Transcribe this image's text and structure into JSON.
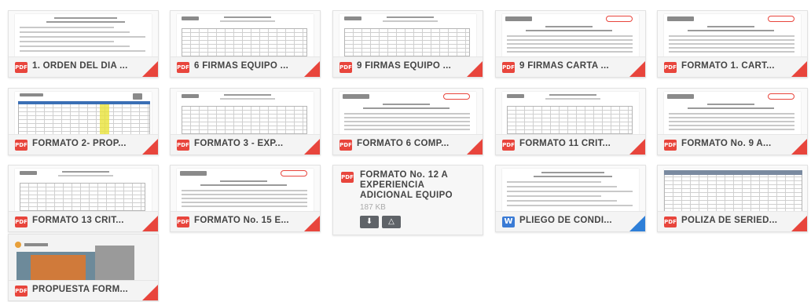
{
  "files": [
    {
      "name": "1. ORDEN DEL DÍA ...",
      "type": "PDF",
      "icon": "pdf-icon",
      "thumb": "text"
    },
    {
      "name": "6 FIRMAS EQUIPO ...",
      "type": "PDF",
      "icon": "pdf-icon",
      "thumb": "table"
    },
    {
      "name": "9 FIRMAS EQUIPO ...",
      "type": "PDF",
      "icon": "pdf-icon",
      "thumb": "table"
    },
    {
      "name": "9 FIRMAS CARTA ...",
      "type": "PDF",
      "icon": "pdf-icon",
      "thumb": "letter"
    },
    {
      "name": "FORMATO 1. CART...",
      "type": "PDF",
      "icon": "pdf-icon",
      "thumb": "letter"
    },
    {
      "name": "FORMATO 2- PROP...",
      "type": "PDF",
      "icon": "pdf-icon",
      "thumb": "spreadsheet"
    },
    {
      "name": "FORMATO 3 - EXP...",
      "type": "PDF",
      "icon": "pdf-icon",
      "thumb": "table"
    },
    {
      "name": "FORMATO 6 COMP...",
      "type": "PDF",
      "icon": "pdf-icon",
      "thumb": "letter"
    },
    {
      "name": "FORMATO 11 CRIT...",
      "type": "PDF",
      "icon": "pdf-icon",
      "thumb": "table"
    },
    {
      "name": "FORMATO No. 9 A...",
      "type": "PDF",
      "icon": "pdf-icon",
      "thumb": "letter"
    },
    {
      "name": "FORMATO 13 CRIT...",
      "type": "PDF",
      "icon": "pdf-icon",
      "thumb": "table"
    },
    {
      "name": "FORMATO No. 15 E...",
      "type": "PDF",
      "icon": "pdf-icon",
      "thumb": "letter"
    },
    {
      "name": "FORMATO No. 12 A EXPERIENCIA ADICIONAL EQUIPO",
      "type": "PDF",
      "icon": "pdf-icon",
      "thumb": "expanded",
      "size": "187 KB"
    },
    {
      "name": "PLIEGO DE CONDI...",
      "type": "W",
      "icon": "word-icon",
      "thumb": "text"
    },
    {
      "name": "PÓLIZA DE SERIED...",
      "type": "PDF",
      "icon": "pdf-icon",
      "thumb": "form"
    },
    {
      "name": "PROPUESTA FORM...",
      "type": "PDF",
      "icon": "pdf-icon",
      "thumb": "photo"
    }
  ],
  "colors": {
    "pdf": "#e8453c",
    "word": "#3a7bd5"
  }
}
